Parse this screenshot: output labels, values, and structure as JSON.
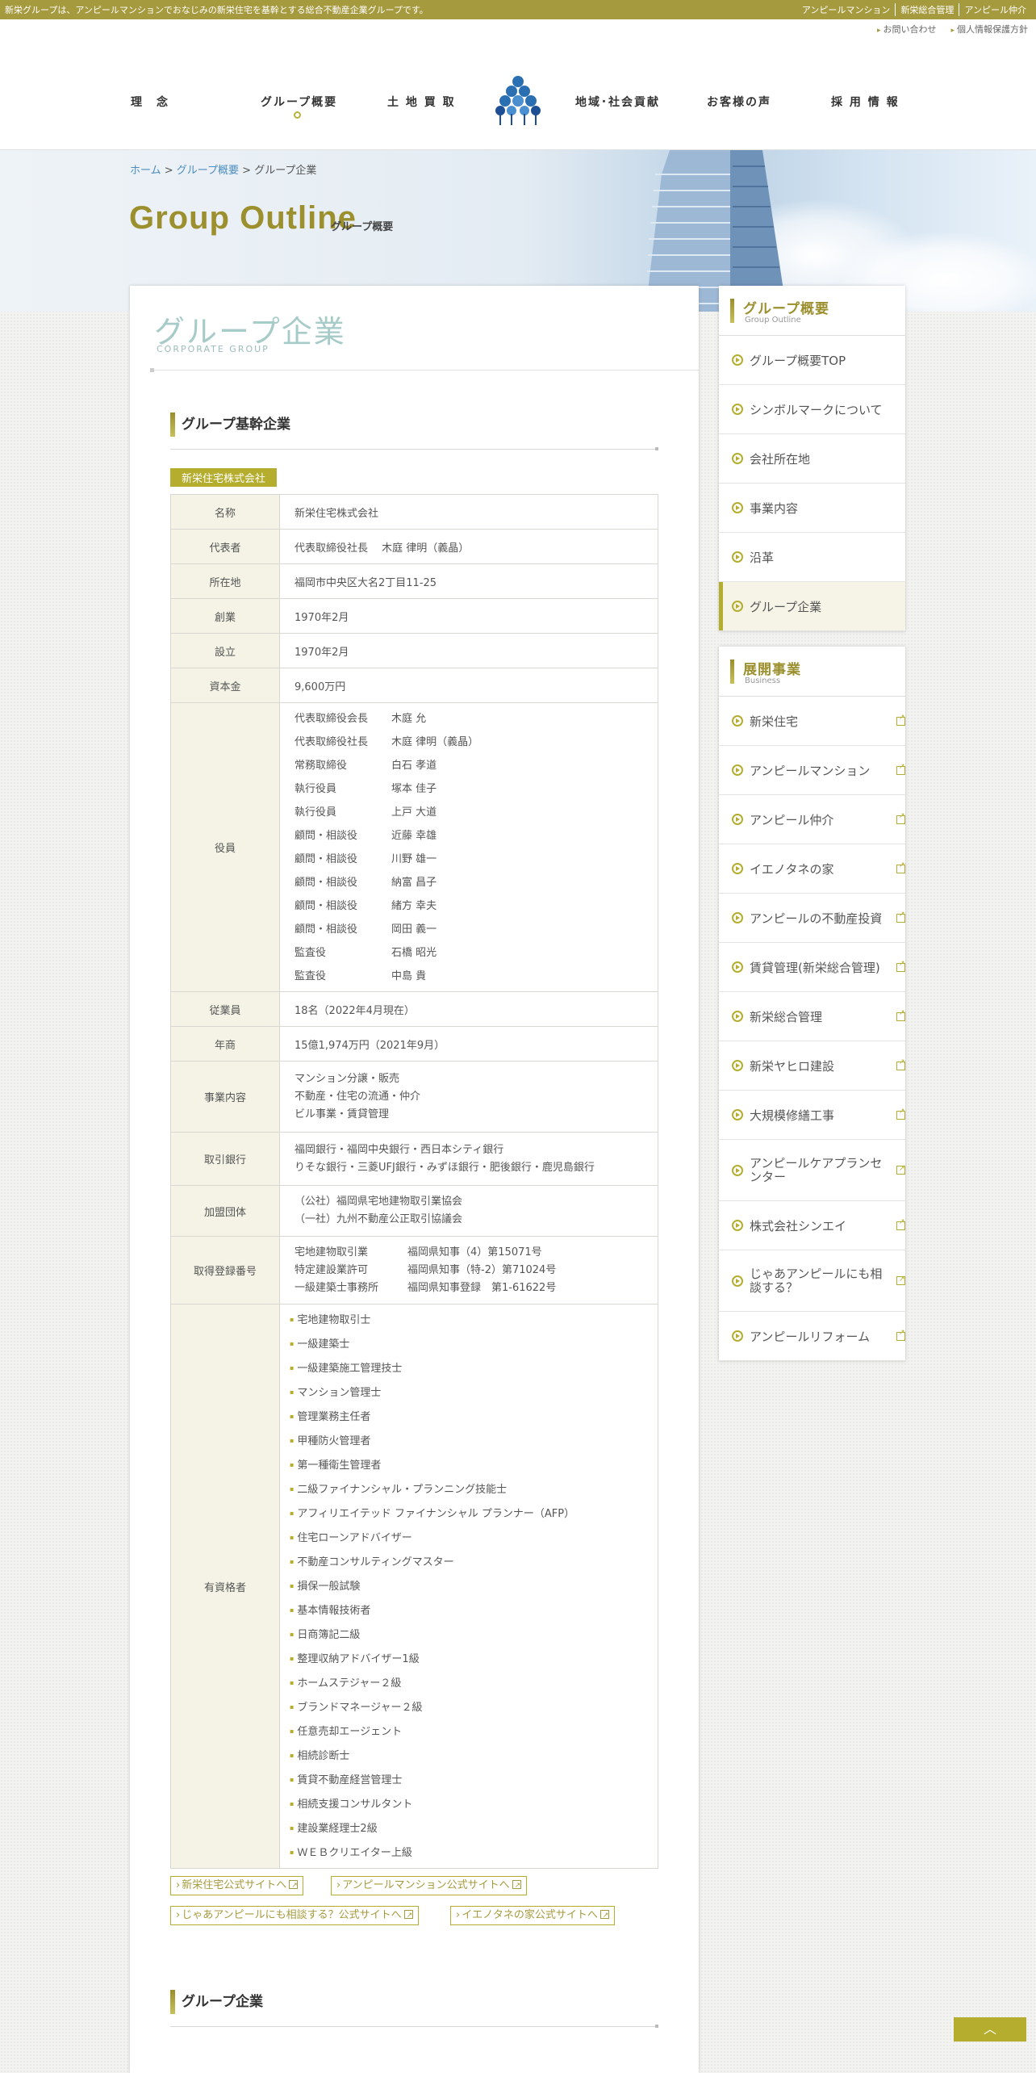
{
  "topbar": {
    "tagline": "新栄グループは、アンピールマンションでおなじみの新栄住宅を基幹とする総合不動産企業グループです。",
    "links": [
      "アンピールマンション",
      "新栄総合管理",
      "アンピール仲介"
    ]
  },
  "subbar": {
    "contact": "お問い合わせ",
    "privacy": "個人情報保護方針"
  },
  "nav": {
    "items": [
      "理　念",
      "グループ概要",
      "土 地 買 取",
      "地域･社会貢献",
      "お客様の声",
      "採 用 情 報"
    ]
  },
  "breadcrumb": {
    "home": "ホーム",
    "sep1": " > ",
    "group": "グループ概要",
    "sep2": " > ",
    "current": "グループ企業"
  },
  "hero": {
    "title": "Group Outline",
    "subtitle": "グループ概要"
  },
  "page": {
    "title": "グループ企業",
    "subtitle": "CORPORATE GROUP"
  },
  "section1": {
    "title": "グループ基幹企業"
  },
  "company": {
    "tag": "新栄住宅株式会社",
    "rows": {
      "name_h": "名称",
      "name": "新栄住宅株式会社",
      "rep_h": "代表者",
      "rep": "代表取締役社長　 木庭 律明（義晶）",
      "addr_h": "所在地",
      "addr": "福岡市中央区大名2丁目11-25",
      "founded_h": "創業",
      "founded": "1970年2月",
      "est_h": "設立",
      "est": "1970年2月",
      "capital_h": "資本金",
      "capital": "9,600万円",
      "officers_h": "役員",
      "employees_h": "従業員",
      "employees": "18名（2022年4月現在）",
      "sales_h": "年商",
      "sales": "15億1,974万円（2021年9月）",
      "biz_h": "事業内容",
      "bank_h": "取引銀行",
      "assoc_h": "加盟団体",
      "reg_h": "取得登録番号",
      "qual_h": "有資格者"
    },
    "officers": [
      {
        "role": "代表取締役会長",
        "name": "木庭 允"
      },
      {
        "role": "代表取締役社長",
        "name": "木庭 律明（義晶）"
      },
      {
        "role": "常務取締役",
        "name": "白石 孝道"
      },
      {
        "role": "執行役員",
        "name": "塚本 佳子"
      },
      {
        "role": "執行役員",
        "name": "上戸 大道"
      },
      {
        "role": "顧問・相談役",
        "name": "近藤 幸雄"
      },
      {
        "role": "顧問・相談役",
        "name": "川野 雄一"
      },
      {
        "role": "顧問・相談役",
        "name": "納富 昌子"
      },
      {
        "role": "顧問・相談役",
        "name": "緒方 幸夫"
      },
      {
        "role": "顧問・相談役",
        "name": "岡田 義一"
      },
      {
        "role": "監査役",
        "name": "石橋 昭光"
      },
      {
        "role": "監査役",
        "name": "中島 貴"
      }
    ],
    "business": [
      "マンション分譲・販売",
      "不動産・住宅の流通・仲介",
      "ビル事業・賃貸管理"
    ],
    "banks": [
      "福岡銀行・福岡中央銀行・西日本シティ銀行",
      "りそな銀行・三菱UFJ銀行・みずほ銀行・肥後銀行・鹿児島銀行"
    ],
    "associations": [
      "（公社）福岡県宅地建物取引業協会",
      "（一社）九州不動産公正取引協議会"
    ],
    "registrations": [
      {
        "k": "宅地建物取引業",
        "v": "福岡県知事（4）第15071号"
      },
      {
        "k": "特定建設業許可",
        "v": "福岡県知事（特-2）第71024号"
      },
      {
        "k": "一級建築士事務所",
        "v": "福岡県知事登録　第1-61622号"
      }
    ],
    "qualifications": [
      "宅地建物取引士",
      "一級建築士",
      "一級建築施工管理技士",
      "マンション管理士",
      "管理業務主任者",
      "甲種防火管理者",
      "第一種衛生管理者",
      "二級ファイナンシャル・プランニング技能士",
      "アフィリエイテッド ファイナンシャル プランナー（AFP）",
      "住宅ローンアドバイザー",
      "不動産コンサルティングマスター",
      "損保一般試験",
      "基本情報技術者",
      "日商簿記二級",
      "整理収納アドバイザー1級",
      "ホームステジャー２級",
      "ブランドマネージャー２級",
      "任意売却エージェント",
      "相続診断士",
      "賃貸不動産経営管理士",
      "相続支援コンサルタント",
      "建設業経理士2級",
      "ＷＥＢクリエイター上級"
    ]
  },
  "links": [
    "新栄住宅公式サイトへ",
    "アンピールマンション公式サイトへ",
    "じゃあアンピールにも相談する？公式サイトへ",
    "イエノタネの家公式サイトへ"
  ],
  "section2": {
    "title": "グループ企業"
  },
  "sidebar1": {
    "title": "グループ概要",
    "subtitle": "Group Outline",
    "items": [
      "グループ概要TOP",
      "シンボルマークについて",
      "会社所在地",
      "事業内容",
      "沿革",
      "グループ企業"
    ]
  },
  "sidebar2": {
    "title": "展開事業",
    "subtitle": "Business",
    "items": [
      "新栄住宅",
      "アンピールマンション",
      "アンピール仲介",
      "イエノタネの家",
      "アンピールの不動産投資",
      "賃貸管理(新栄総合管理)",
      "新栄総合管理",
      "新栄ヤヒロ建設",
      "大規模修繕工事",
      "アンピールケアプランセンター",
      "株式会社シンエイ",
      "じゃあアンピールにも相談する？",
      "アンピールリフォーム"
    ]
  },
  "colors": {
    "accent": "#b5ad2d",
    "topbar": "#a69a3e",
    "title_teal": "#a7cbc9",
    "link_blue": "#4b8dbf"
  }
}
